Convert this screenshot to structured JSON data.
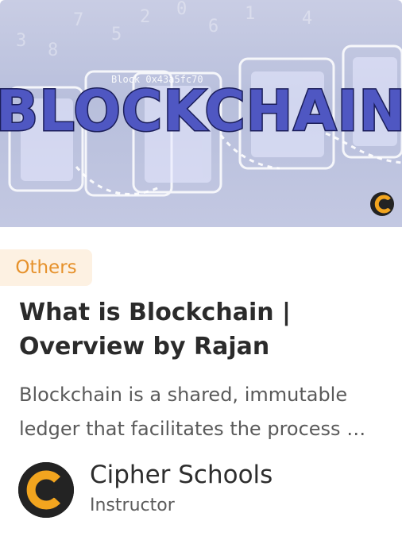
{
  "thumbnail": {
    "banner_text": "BLOCKCHAIN",
    "overlay_text": "Block 0x43a5fc70",
    "brand_logo": "cipher-schools-logo"
  },
  "course": {
    "category": "Others",
    "title": "What is Blockchain | Overview by Rajan",
    "description": "Blockchain is a shared, immutable ledger that facilitates the process of recording transactions and tracking assets in a business network."
  },
  "author": {
    "name": "Cipher Schools",
    "role": "Instructor",
    "avatar_icon": "cipher-schools-logo"
  },
  "colors": {
    "accent": "#e6912b",
    "category_bg": "#fdf1e2",
    "banner_text": "#2a2e6e"
  }
}
